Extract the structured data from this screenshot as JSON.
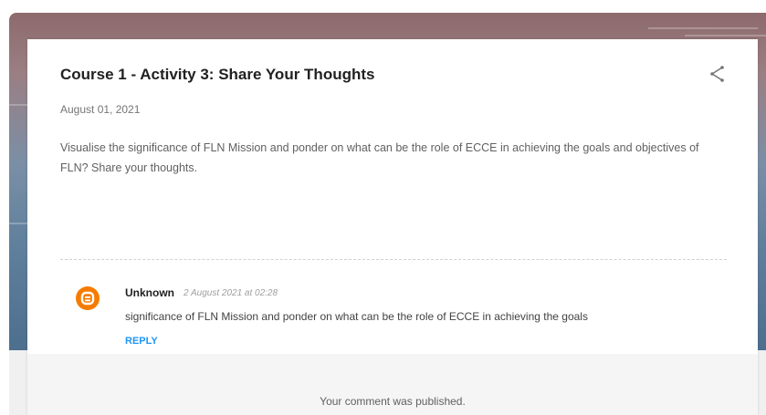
{
  "post": {
    "title": "Course 1 - Activity 3: Share Your Thoughts",
    "date": "August 01, 2021",
    "body": "Visualise the significance of FLN Mission and ponder on what can be the role of ECCE in achieving the goals and objectives of FLN? Share your thoughts."
  },
  "comment": {
    "author": "Unknown",
    "timestamp": "2 August 2021 at 02:28",
    "text": "significance of FLN Mission and ponder on what can be the role of ECCE in achieving the goals",
    "reply_label": "REPLY",
    "avatar_icon": "blogger-icon",
    "avatar_color": "#f57c00"
  },
  "share_icon": "share-icon",
  "status": {
    "published_message": "Your comment was published."
  }
}
